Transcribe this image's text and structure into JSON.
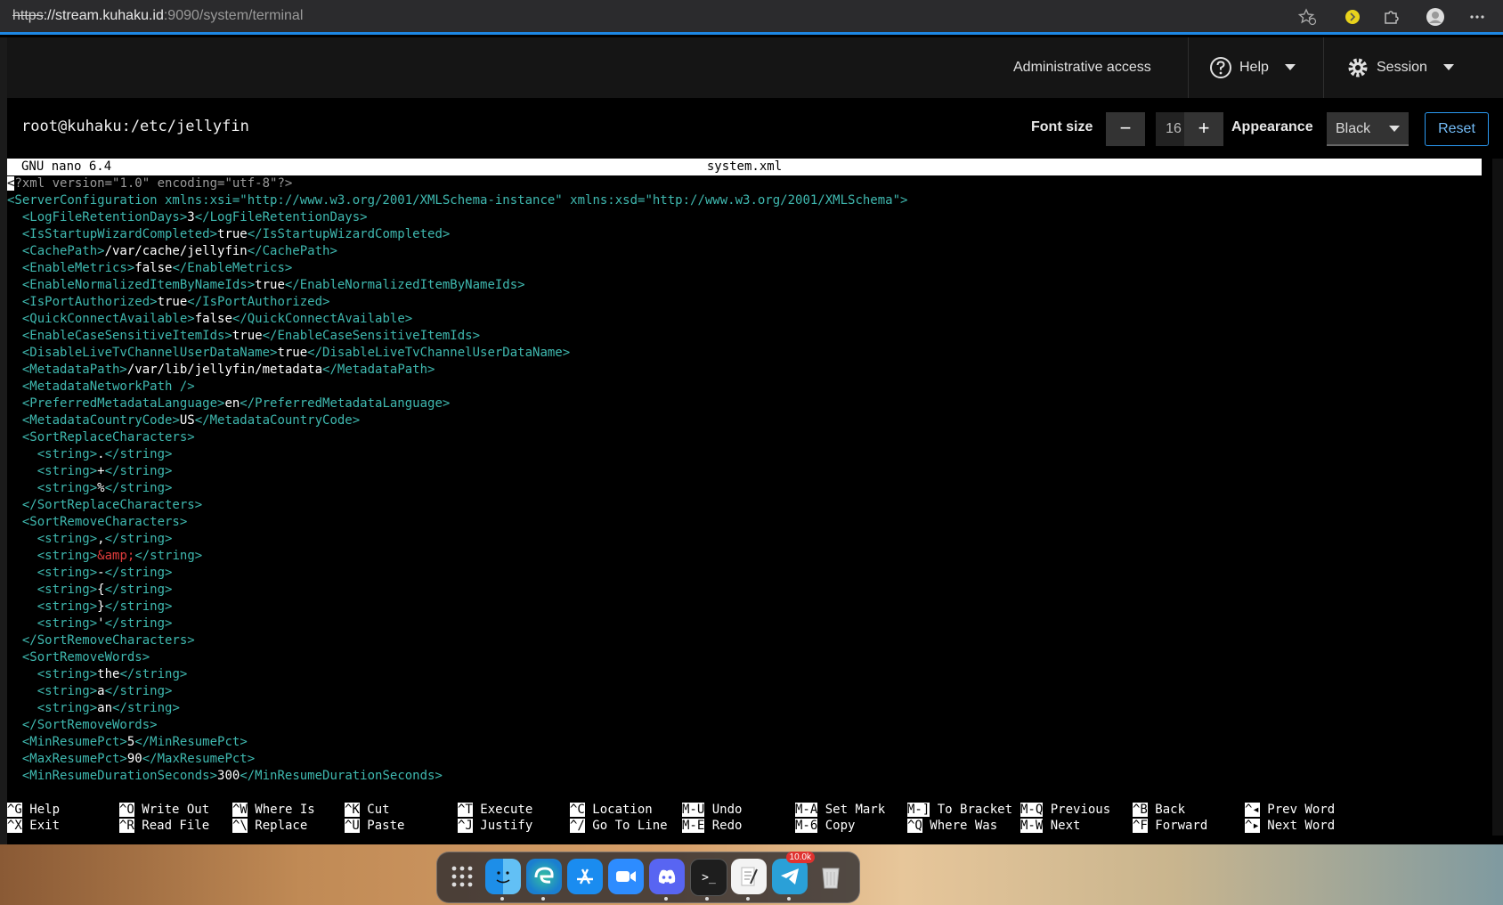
{
  "browser": {
    "url_scheme": "https",
    "url_host": "://stream.kuhaku.id",
    "url_rest": ":9090/system/terminal",
    "icons": [
      "favorite-icon",
      "extension-yellow-icon",
      "puzzle-icon",
      "profile-avatar-icon",
      "more-icon"
    ]
  },
  "header": {
    "admin": "Administrative access",
    "help": "Help",
    "session": "Session"
  },
  "toolbar": {
    "host": "root@kuhaku:/etc/jellyfin",
    "font_size_label": "Font size",
    "font_size_value": "16",
    "minus": "−",
    "plus": "+",
    "appearance_label": "Appearance",
    "appearance_value": "Black",
    "reset": "Reset"
  },
  "nano": {
    "version": "GNU nano 6.4",
    "filename": "system.xml"
  },
  "lines": [
    [
      [
        "cursor",
        "<"
      ],
      [
        "dim",
        "?xml version=\"1.0\" encoding=\"utf-8\"?>"
      ]
    ],
    [
      [
        "t",
        "<ServerConfiguration xmlns:xsi=\"http://www.w3.org/2001/XMLSchema-instance\" xmlns:xsd=\"http://www.w3.org/2001/XMLSchema\">"
      ]
    ],
    [
      [
        "p",
        "  "
      ],
      [
        "t",
        "<LogFileRetentionDays>"
      ],
      [
        "p",
        "3"
      ],
      [
        "t",
        "</LogFileRetentionDays>"
      ]
    ],
    [
      [
        "p",
        "  "
      ],
      [
        "t",
        "<IsStartupWizardCompleted>"
      ],
      [
        "p",
        "true"
      ],
      [
        "t",
        "</IsStartupWizardCompleted>"
      ]
    ],
    [
      [
        "p",
        "  "
      ],
      [
        "t",
        "<CachePath>"
      ],
      [
        "p",
        "/var/cache/jellyfin"
      ],
      [
        "t",
        "</CachePath>"
      ]
    ],
    [
      [
        "p",
        "  "
      ],
      [
        "t",
        "<EnableMetrics>"
      ],
      [
        "p",
        "false"
      ],
      [
        "t",
        "</EnableMetrics>"
      ]
    ],
    [
      [
        "p",
        "  "
      ],
      [
        "t",
        "<EnableNormalizedItemByNameIds>"
      ],
      [
        "p",
        "true"
      ],
      [
        "t",
        "</EnableNormalizedItemByNameIds>"
      ]
    ],
    [
      [
        "p",
        "  "
      ],
      [
        "t",
        "<IsPortAuthorized>"
      ],
      [
        "p",
        "true"
      ],
      [
        "t",
        "</IsPortAuthorized>"
      ]
    ],
    [
      [
        "p",
        "  "
      ],
      [
        "t",
        "<QuickConnectAvailable>"
      ],
      [
        "p",
        "false"
      ],
      [
        "t",
        "</QuickConnectAvailable>"
      ]
    ],
    [
      [
        "p",
        "  "
      ],
      [
        "t",
        "<EnableCaseSensitiveItemIds>"
      ],
      [
        "p",
        "true"
      ],
      [
        "t",
        "</EnableCaseSensitiveItemIds>"
      ]
    ],
    [
      [
        "p",
        "  "
      ],
      [
        "t",
        "<DisableLiveTvChannelUserDataName>"
      ],
      [
        "p",
        "true"
      ],
      [
        "t",
        "</DisableLiveTvChannelUserDataName>"
      ]
    ],
    [
      [
        "p",
        "  "
      ],
      [
        "t",
        "<MetadataPath>"
      ],
      [
        "p",
        "/var/lib/jellyfin/metadata"
      ],
      [
        "t",
        "</MetadataPath>"
      ]
    ],
    [
      [
        "p",
        "  "
      ],
      [
        "t",
        "<MetadataNetworkPath />"
      ]
    ],
    [
      [
        "p",
        "  "
      ],
      [
        "t",
        "<PreferredMetadataLanguage>"
      ],
      [
        "p",
        "en"
      ],
      [
        "t",
        "</PreferredMetadataLanguage>"
      ]
    ],
    [
      [
        "p",
        "  "
      ],
      [
        "t",
        "<MetadataCountryCode>"
      ],
      [
        "p",
        "US"
      ],
      [
        "t",
        "</MetadataCountryCode>"
      ]
    ],
    [
      [
        "p",
        "  "
      ],
      [
        "t",
        "<SortReplaceCharacters>"
      ]
    ],
    [
      [
        "p",
        "    "
      ],
      [
        "t",
        "<string>"
      ],
      [
        "p",
        "."
      ],
      [
        "t",
        "</string>"
      ]
    ],
    [
      [
        "p",
        "    "
      ],
      [
        "t",
        "<string>"
      ],
      [
        "p",
        "+"
      ],
      [
        "t",
        "</string>"
      ]
    ],
    [
      [
        "p",
        "    "
      ],
      [
        "t",
        "<string>"
      ],
      [
        "p",
        "%"
      ],
      [
        "t",
        "</string>"
      ]
    ],
    [
      [
        "p",
        "  "
      ],
      [
        "t",
        "</SortReplaceCharacters>"
      ]
    ],
    [
      [
        "p",
        "  "
      ],
      [
        "t",
        "<SortRemoveCharacters>"
      ]
    ],
    [
      [
        "p",
        "    "
      ],
      [
        "t",
        "<string>"
      ],
      [
        "p",
        ","
      ],
      [
        "t",
        "</string>"
      ]
    ],
    [
      [
        "p",
        "    "
      ],
      [
        "t",
        "<string>"
      ],
      [
        "ent",
        "&amp;"
      ],
      [
        "t",
        "</string>"
      ]
    ],
    [
      [
        "p",
        "    "
      ],
      [
        "t",
        "<string>"
      ],
      [
        "p",
        "-"
      ],
      [
        "t",
        "</string>"
      ]
    ],
    [
      [
        "p",
        "    "
      ],
      [
        "t",
        "<string>"
      ],
      [
        "p",
        "{"
      ],
      [
        "t",
        "</string>"
      ]
    ],
    [
      [
        "p",
        "    "
      ],
      [
        "t",
        "<string>"
      ],
      [
        "p",
        "}"
      ],
      [
        "t",
        "</string>"
      ]
    ],
    [
      [
        "p",
        "    "
      ],
      [
        "t",
        "<string>"
      ],
      [
        "p",
        "'"
      ],
      [
        "t",
        "</string>"
      ]
    ],
    [
      [
        "p",
        "  "
      ],
      [
        "t",
        "</SortRemoveCharacters>"
      ]
    ],
    [
      [
        "p",
        "  "
      ],
      [
        "t",
        "<SortRemoveWords>"
      ]
    ],
    [
      [
        "p",
        "    "
      ],
      [
        "t",
        "<string>"
      ],
      [
        "p",
        "the"
      ],
      [
        "t",
        "</string>"
      ]
    ],
    [
      [
        "p",
        "    "
      ],
      [
        "t",
        "<string>"
      ],
      [
        "p",
        "a"
      ],
      [
        "t",
        "</string>"
      ]
    ],
    [
      [
        "p",
        "    "
      ],
      [
        "t",
        "<string>"
      ],
      [
        "p",
        "an"
      ],
      [
        "t",
        "</string>"
      ]
    ],
    [
      [
        "p",
        "  "
      ],
      [
        "t",
        "</SortRemoveWords>"
      ]
    ],
    [
      [
        "p",
        "  "
      ],
      [
        "t",
        "<MinResumePct>"
      ],
      [
        "p",
        "5"
      ],
      [
        "t",
        "</MinResumePct>"
      ]
    ],
    [
      [
        "p",
        "  "
      ],
      [
        "t",
        "<MaxResumePct>"
      ],
      [
        "p",
        "90"
      ],
      [
        "t",
        "</MaxResumePct>"
      ]
    ],
    [
      [
        "p",
        "  "
      ],
      [
        "t",
        "<MinResumeDurationSeconds>"
      ],
      [
        "p",
        "300"
      ],
      [
        "t",
        "</MinResumeDurationSeconds>"
      ]
    ]
  ],
  "shortcuts": [
    {
      "key": "^G",
      "label": "Help"
    },
    {
      "key": "^O",
      "label": "Write Out"
    },
    {
      "key": "^W",
      "label": "Where Is"
    },
    {
      "key": "^K",
      "label": "Cut"
    },
    {
      "key": "^T",
      "label": "Execute"
    },
    {
      "key": "^C",
      "label": "Location"
    },
    {
      "key": "M-U",
      "label": "Undo"
    },
    {
      "key": "M-A",
      "label": "Set Mark"
    },
    {
      "key": "M-]",
      "label": "To Bracket"
    },
    {
      "key": "M-Q",
      "label": "Previous"
    },
    {
      "key": "^B",
      "label": "Back"
    },
    {
      "key": "^◂",
      "label": "Prev Word"
    },
    {
      "key": "^X",
      "label": "Exit"
    },
    {
      "key": "^R",
      "label": "Read File"
    },
    {
      "key": "^\\",
      "label": "Replace"
    },
    {
      "key": "^U",
      "label": "Paste"
    },
    {
      "key": "^J",
      "label": "Justify"
    },
    {
      "key": "^/",
      "label": "Go To Line"
    },
    {
      "key": "M-E",
      "label": "Redo"
    },
    {
      "key": "M-6",
      "label": "Copy"
    },
    {
      "key": "^Q",
      "label": "Where Was"
    },
    {
      "key": "M-W",
      "label": "Next"
    },
    {
      "key": "^F",
      "label": "Forward"
    },
    {
      "key": "^▸",
      "label": "Next Word"
    }
  ],
  "dock": {
    "apps": [
      "launchpad-icon",
      "finder-icon",
      "edge-icon",
      "app-store-icon",
      "zoom-icon",
      "discord-icon",
      "terminal-icon",
      "textedit-icon",
      "telegram-icon",
      "trash-icon"
    ],
    "telegram_badge": "10.0k"
  }
}
